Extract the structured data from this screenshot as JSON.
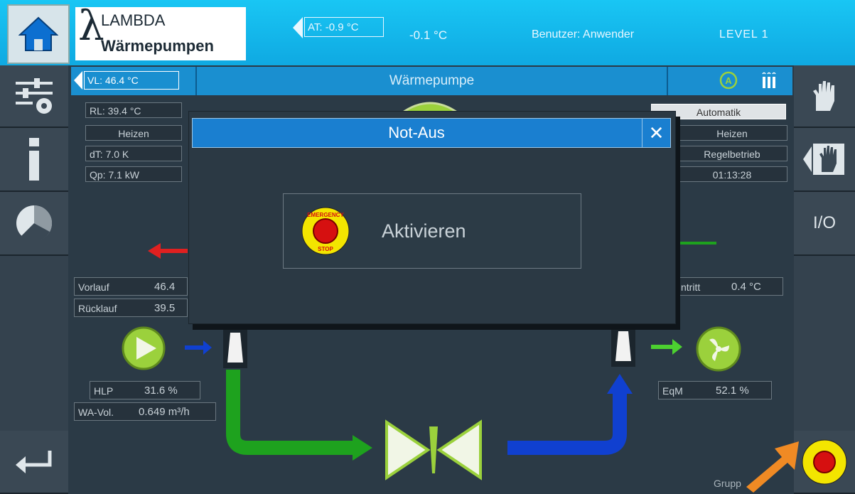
{
  "header": {
    "logo_top": "LAMBDA",
    "logo_bottom": "Wärmepumpen",
    "at_label": "AT: -0.9 °C",
    "temperature": "-0.1 °C",
    "user_label": "Benutzer: Anwender",
    "level_label": "LEVEL 1"
  },
  "title_bar": {
    "vl_label": "VL: 46.4 °C",
    "title": "Wärmepumpe"
  },
  "left_values": {
    "rl": "RL: 39.4 °C",
    "mode": "Heizen",
    "dt": "dT: 7.0 K",
    "qp": "Qp: 7.1 kW"
  },
  "right_values": {
    "automatic": "Automatik",
    "mode": "Heizen",
    "operation": "Regelbetrieb",
    "time": "01:13:28"
  },
  "readouts": {
    "vorlauf_label": "Vorlauf",
    "vorlauf_value": "46.4",
    "ruecklauf_label": "Rücklauf",
    "ruecklauf_value": "39.5",
    "eintritt_label": "ntritt",
    "eintritt_value": "0.4 °C",
    "hlp_label": "HLP",
    "hlp_value": "31.6 %",
    "wa_label": "WA-Vol.",
    "wa_value": "0.649 m³/h",
    "eqm_label": "EqM",
    "eqm_value": "52.1 %",
    "gruppe": "Grupp"
  },
  "sidebar": {
    "io_label": "I/O"
  },
  "modal": {
    "title": "Not-Aus",
    "close": "✕",
    "button_label": "Aktivieren",
    "stop_top": "EMERGENCY",
    "stop_bottom": "STOP"
  },
  "colors": {
    "header_bg": "#16b9ee",
    "title_bar": "#1a8fd0",
    "panel_bg": "#2b3a46",
    "pump_green": "#9bd13c",
    "pipe_green": "#1ea21e",
    "pipe_blue": "#1040d0",
    "arrow_red": "#e02020",
    "orange_arrow": "#f08a24"
  }
}
